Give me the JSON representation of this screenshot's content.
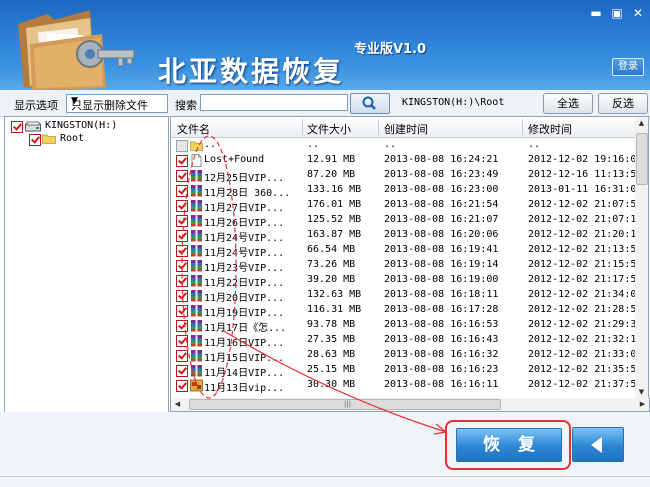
{
  "app": {
    "title": "北亚数据恢复",
    "edition": "专业版V1.0",
    "login_label": "登录",
    "window_buttons": {
      "minimize": "▬",
      "maximize": "▣",
      "close": "✕"
    }
  },
  "toolbar": {
    "display_label": "显示选项",
    "filter_value": "只显示删除文件",
    "search_label": "搜索",
    "search_value": "",
    "path": "KINGSTON(H:)\\Root",
    "select_all_label": "全选",
    "invert_label": "反选"
  },
  "tree": {
    "drive_label": "KINGSTON(H:)",
    "root_label": "Root"
  },
  "file_list": {
    "columns": [
      "文件名",
      "文件大小",
      "创建时间",
      "修改时间"
    ],
    "rows": [
      {
        "name": "..",
        "size": "..",
        "created": "..",
        "modified": "..",
        "icon": "folder-icon",
        "checked": false
      },
      {
        "name": "Lost+Found",
        "size": "12.91 MB",
        "created": "2013-08-08 16:24:21",
        "modified": "2012-12-02 19:16:0",
        "icon": "document-icon",
        "checked": true
      },
      {
        "name": "12月25日VIP...",
        "size": "87.20 MB",
        "created": "2013-08-08 16:23:49",
        "modified": "2012-12-16 11:13:5",
        "icon": "archive-icon",
        "checked": true
      },
      {
        "name": "11月28日 360...",
        "size": "133.16 MB",
        "created": "2013-08-08 16:23:00",
        "modified": "2013-01-11 16:31:0",
        "icon": "archive-icon",
        "checked": true
      },
      {
        "name": "11月27日VIP...",
        "size": "176.01 MB",
        "created": "2013-08-08 16:21:54",
        "modified": "2012-12-02 21:07:5",
        "icon": "archive-icon",
        "checked": true
      },
      {
        "name": "11月26日VIP...",
        "size": "125.52 MB",
        "created": "2013-08-08 16:21:07",
        "modified": "2012-12-02 21:07:1",
        "icon": "archive-icon",
        "checked": true
      },
      {
        "name": "11月24号VIP...",
        "size": "163.87 MB",
        "created": "2013-08-08 16:20:06",
        "modified": "2012-12-02 21:20:1",
        "icon": "archive-icon",
        "checked": true
      },
      {
        "name": "11月24号VIP...",
        "size": "66.54 MB",
        "created": "2013-08-08 16:19:41",
        "modified": "2012-12-02 21:13:5",
        "icon": "archive-icon",
        "checked": true
      },
      {
        "name": "11月23号VIP...",
        "size": "73.26 MB",
        "created": "2013-08-08 16:19:14",
        "modified": "2012-12-02 21:15:5",
        "icon": "archive-icon",
        "checked": true
      },
      {
        "name": "11月22日VIP...",
        "size": "39.20 MB",
        "created": "2013-08-08 16:19:00",
        "modified": "2012-12-02 21:17:5",
        "icon": "archive-icon",
        "checked": true
      },
      {
        "name": "11月20日VIP...",
        "size": "132.63 MB",
        "created": "2013-08-08 16:18:11",
        "modified": "2012-12-02 21:34:0",
        "icon": "archive-icon",
        "checked": true
      },
      {
        "name": "11月19日VIP...",
        "size": "116.31 MB",
        "created": "2013-08-08 16:17:28",
        "modified": "2012-12-02 21:28:5",
        "icon": "archive-icon",
        "checked": true
      },
      {
        "name": "11月17日《怎...",
        "size": "93.78 MB",
        "created": "2013-08-08 16:16:53",
        "modified": "2012-12-02 21:29:3",
        "icon": "archive-icon",
        "checked": true
      },
      {
        "name": "11月16日VIP...",
        "size": "27.35 MB",
        "created": "2013-08-08 16:16:43",
        "modified": "2012-12-02 21:32:1",
        "icon": "archive-icon",
        "checked": true
      },
      {
        "name": "11月15日VIP...",
        "size": "28.63 MB",
        "created": "2013-08-08 16:16:32",
        "modified": "2012-12-02 21:33:0",
        "icon": "archive-icon",
        "checked": true
      },
      {
        "name": "11月14日VIP...",
        "size": "25.15 MB",
        "created": "2013-08-08 16:16:23",
        "modified": "2012-12-02 21:35:5",
        "icon": "archive-icon",
        "checked": true
      },
      {
        "name": "11月13日vip...",
        "size": "30.30 MB",
        "created": "2013-08-08 16:16:11",
        "modified": "2012-12-02 21:37:5",
        "icon": "image-archive-icon",
        "checked": true
      }
    ]
  },
  "bottom": {
    "recover_label": "恢 复"
  },
  "colors": {
    "header_blue": "#2e82d8",
    "annotation_red": "#e53030",
    "checkbox_red": "#d01a1a"
  }
}
